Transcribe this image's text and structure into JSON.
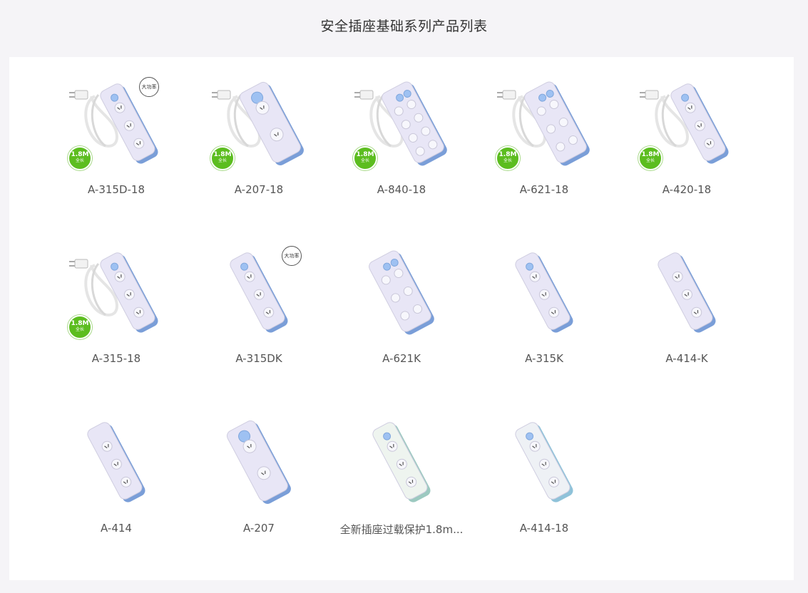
{
  "page": {
    "title": "安全插座基础系列产品列表"
  },
  "products": [
    {
      "name": "A-315D-18",
      "badge_length": "1.8M",
      "badge_sub": "全长",
      "tag": "大功率",
      "variant": "cord3_button"
    },
    {
      "name": "A-207-18",
      "badge_length": "1.8M",
      "badge_sub": "全长",
      "tag": "",
      "variant": "cord_wide"
    },
    {
      "name": "A-840-18",
      "badge_length": "1.8M",
      "badge_sub": "全长",
      "tag": "",
      "variant": "cord8"
    },
    {
      "name": "A-621-18",
      "badge_length": "1.8M",
      "badge_sub": "全长",
      "tag": "",
      "variant": "cord6"
    },
    {
      "name": "A-420-18",
      "badge_length": "1.8M",
      "badge_sub": "全长",
      "tag": "",
      "variant": "cord4"
    },
    {
      "name": "A-315-18",
      "badge_length": "1.8M",
      "badge_sub": "全长",
      "tag": "",
      "variant": "cord3"
    },
    {
      "name": "A-315DK",
      "badge_length": "",
      "badge_sub": "",
      "tag": "大功率",
      "variant": "strip3"
    },
    {
      "name": "A-621K",
      "badge_length": "",
      "badge_sub": "",
      "tag": "",
      "variant": "strip6"
    },
    {
      "name": "A-315K",
      "badge_length": "",
      "badge_sub": "",
      "tag": "",
      "variant": "strip3b"
    },
    {
      "name": "A-414-K",
      "badge_length": "",
      "badge_sub": "",
      "tag": "",
      "variant": "strip4"
    },
    {
      "name": "A-414",
      "badge_length": "",
      "badge_sub": "",
      "tag": "",
      "variant": "strip4"
    },
    {
      "name": "A-207",
      "badge_length": "",
      "badge_sub": "",
      "tag": "",
      "variant": "strip2"
    },
    {
      "name": "全新插座过载保护1.8m...",
      "badge_length": "",
      "badge_sub": "",
      "tag": "",
      "variant": "strip4green"
    },
    {
      "name": "A-414-18",
      "badge_length": "",
      "badge_sub": "",
      "tag": "",
      "variant": "strip4blue"
    }
  ],
  "icons": {
    "product_image": "power-strip-icon",
    "length_badge": "length-badge-icon",
    "power_tag": "high-power-tag-icon"
  },
  "colors": {
    "background": "#f5f4f7",
    "panel": "#ffffff",
    "badge_green": "#5cbd1f",
    "strip_body": "#e6e4f5",
    "switch_blue": "#8fb8f0"
  }
}
